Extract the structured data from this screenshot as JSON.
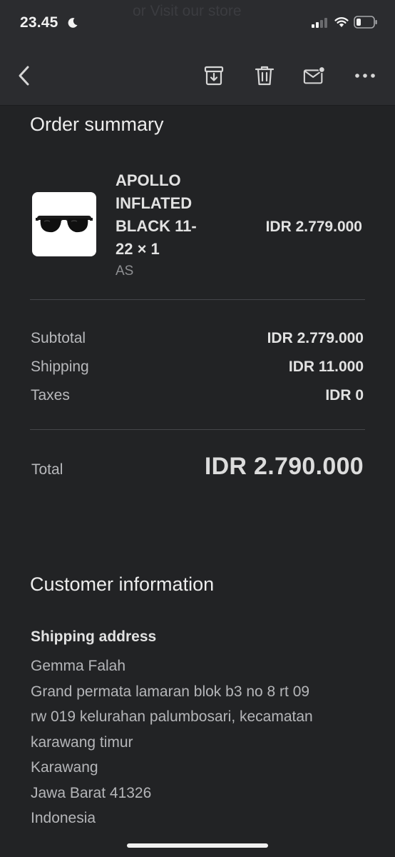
{
  "status_bar": {
    "time": "23.45",
    "ghost_text": "or Visit our store"
  },
  "toolbar": {
    "icons": [
      "back-chevron-icon",
      "archive-icon",
      "trash-icon",
      "mark-unread-icon",
      "more-icon"
    ]
  },
  "order_summary": {
    "title": "Order summary",
    "item": {
      "name": "APOLLO INFLATED BLACK 11-22 × 1",
      "variant": "AS",
      "price": "IDR 2.779.000"
    },
    "subtotal_label": "Subtotal",
    "subtotal_value": "IDR 2.779.000",
    "shipping_label": "Shipping",
    "shipping_value": "IDR 11.000",
    "taxes_label": "Taxes",
    "taxes_value": "IDR 0",
    "total_label": "Total",
    "total_value": "IDR 2.790.000"
  },
  "customer_information": {
    "title": "Customer information",
    "shipping_address_label": "Shipping address",
    "address_lines": [
      "Gemma Falah",
      "Grand permata lamaran blok b3 no 8 rt 09",
      "rw 019 kelurahan palumbosari, kecamatan",
      "karawang timur",
      "Karawang",
      "Jawa Barat 41326",
      "Indonesia"
    ]
  },
  "colors": {
    "background": "#222325",
    "toolbar": "#2b2c2f",
    "text_primary": "#e2e2e2",
    "text_secondary": "#b8b9bc"
  }
}
